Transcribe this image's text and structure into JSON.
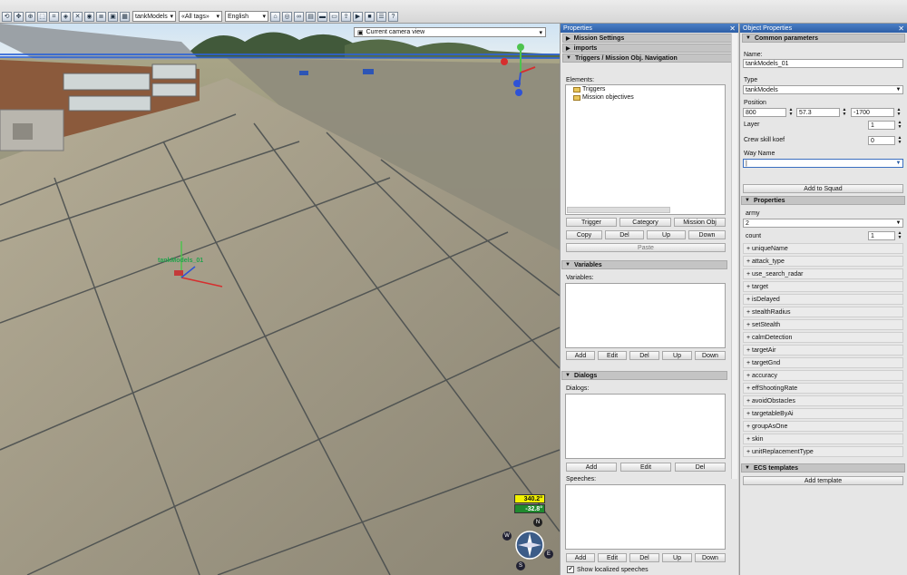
{
  "toolbar": {
    "icons": [
      "rotate-icon",
      "move-icon",
      "zoom-icon",
      "select-icon",
      "select-area-icon",
      "object-icon",
      "erase-icon",
      "globe-icon",
      "layers-icon",
      "cube-icon",
      "grid-icon",
      "camera-icon",
      "eye-icon",
      "binoculars-icon",
      "open-icon",
      "save-icon",
      "save-as-icon",
      "export-icon",
      "play-icon",
      "stop-icon",
      "report-icon",
      "help-icon"
    ],
    "model_select": "tankModels",
    "tags_select": "«All tags»",
    "language_select": "English"
  },
  "viewport": {
    "camera_view": "Current camera view",
    "unit_label": "tankModels_01",
    "heading": "340.2°",
    "pitch": "-32.8°",
    "compass": {
      "n": "N",
      "w": "W",
      "e": "E",
      "s": "S"
    }
  },
  "properties_panel": {
    "title": "Properties",
    "sections": {
      "mission_settings": "Mission Settings",
      "imports": "imports",
      "triggers": "Triggers / Mission Obj. Navigation",
      "variables": "Variables",
      "dialogs": "Dialogs"
    },
    "elements_label": "Elements:",
    "tree": [
      "Triggers",
      "Mission objectives"
    ],
    "trigger_buttons": {
      "trigger": "Trigger",
      "category": "Category",
      "mission_obj": "Mission Obj",
      "copy": "Copy",
      "del": "Del",
      "up": "Up",
      "down": "Down",
      "paste": "Paste"
    },
    "variables_label": "Variables:",
    "variable_buttons": {
      "add": "Add",
      "edit": "Edit",
      "del": "Del",
      "up": "Up",
      "down": "Down"
    },
    "dialogs_label": "Dialogs:",
    "dialog_buttons": {
      "add": "Add",
      "edit": "Edit",
      "del": "Del"
    },
    "speeches_label": "Speeches:",
    "speech_buttons": {
      "add": "Add",
      "edit": "Edit",
      "del": "Del",
      "up": "Up",
      "down": "Down"
    },
    "show_localized": "Show localized speeches"
  },
  "object_panel": {
    "title": "Object Properties",
    "common_header": "Common parameters",
    "name_label": "Name:",
    "name_value": "tankModels_01",
    "type_label": "Type",
    "type_value": "tankModels",
    "position_label": "Position",
    "pos_x": "800",
    "pos_y": "57.3",
    "pos_z": "-1700",
    "layer_label": "Layer",
    "layer_value": "1",
    "crew_label": "Crew skill koef",
    "crew_value": "0",
    "way_label": "Way Name",
    "way_value": "|",
    "add_squad": "Add to Squad",
    "props_header": "Properties",
    "army_label": "army",
    "army_value": "2",
    "count_label": "count",
    "count_value": "1",
    "props": [
      "+ uniqueName",
      "+ attack_type",
      "+ use_search_radar",
      "+ target",
      "+ isDelayed",
      "+ stealthRadius",
      "+ setStealth",
      "+ calmDetection",
      "+ targetAir",
      "+ targetGnd",
      "+ accuracy",
      "+ effShootingRate",
      "+ avoidObstacles",
      "+ targetableByAi",
      "+ groupAsOne",
      "+ skin",
      "+ unitReplacementType"
    ],
    "ecs_header": "ECS templates",
    "add_template": "Add template"
  }
}
